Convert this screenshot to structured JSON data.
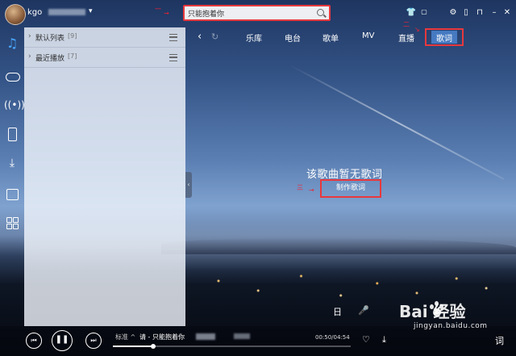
{
  "header": {
    "username": "kgo",
    "search_value": "只能抱着你",
    "annotation_one": "一",
    "annotation_two": "二",
    "annotation_three": "三"
  },
  "nav": {
    "tabs": [
      "乐库",
      "电台",
      "歌单",
      "MV",
      "直播",
      "歌词"
    ],
    "active_tab": "歌词"
  },
  "playlist": [
    {
      "name": "默认列表",
      "count": "[9]"
    },
    {
      "name": "最近播放",
      "count": "[7]"
    }
  ],
  "lyrics": {
    "empty_message": "该歌曲暂无歌词",
    "make_button": "制作歌词"
  },
  "player": {
    "quality": "标准 ^",
    "now_playing": "请 - 只能抱着你",
    "time": "00:50/04:54",
    "progress": 0.17,
    "lyrics_toggle": "词"
  },
  "watermark": {
    "brand": "Bai  经验",
    "site": "jingyan.baidu.com"
  },
  "colors": {
    "annotation_red": "#e8383d",
    "active_tab_bg": "#508cdc",
    "icon_accent": "#4aa8ff"
  }
}
